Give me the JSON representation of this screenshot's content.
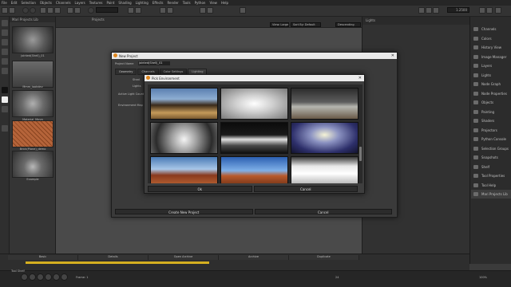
{
  "menu": [
    "File",
    "Edit",
    "Selection",
    "Objects",
    "Channels",
    "Layers",
    "Textures",
    "Paint",
    "Shading",
    "Lighting",
    "Effects",
    "Render",
    "Tools",
    "Python",
    "View",
    "Help"
  ],
  "toolbar": {
    "camera_label": "Camera",
    "size_value": "1024",
    "zoom": "1.2500"
  },
  "projects_panel": {
    "title": "Mari Projects Lib",
    "items": [
      {
        "name": "jointed(Shell)_01",
        "icon": "hexnut-thumbnail"
      },
      {
        "name": "Mmm_lookdev",
        "icon": "robot-thumbnail"
      },
      {
        "name": "Material_Mmm",
        "icon": "grey-sphere-thumbnail"
      },
      {
        "name": "Brick(Plane)_demo",
        "icon": "brick-thumbnail"
      },
      {
        "name": "Example",
        "icon": "box-thumbnail"
      }
    ]
  },
  "viewport": {
    "title": "Projects",
    "view_mode": "View: Large",
    "sort": "Sort By: Default",
    "order": "Descending"
  },
  "right_panel": {
    "title": "Lights"
  },
  "palettes": [
    "Channels",
    "Colors",
    "History View",
    "Image Manager",
    "Layers",
    "Lights",
    "Node Graph",
    "Node Properties",
    "Objects",
    "Painting",
    "Shaders",
    "Projectors",
    "Python Console",
    "Selection Groups",
    "Snapshots",
    "Shelf",
    "Tool Properties",
    "Tool Help",
    "Mari Projects Lib"
  ],
  "shelf": {
    "tabs": [
      "Basic",
      "Details",
      "Open Archive",
      "Archive",
      "Duplicate"
    ],
    "label": "Tool Shelf"
  },
  "statusbar": {
    "frame": "Frame: 1",
    "fps": "24",
    "zoom": "100%"
  },
  "new_project_dialog": {
    "title": "New Project",
    "name_label": "Project Name",
    "name_value": "jointed(Shell)_01",
    "tabs": [
      "Geometry",
      "Channels",
      "Color Settings",
      "Lighting"
    ],
    "rows": [
      "Shad",
      "Lights",
      "Active Light Count",
      "Environment Map"
    ],
    "create_button": "Create New Project",
    "cancel_button": "Cancel"
  },
  "env_picker": {
    "title": "Pick Environment",
    "ok_button": "Ok",
    "cancel_button": "Cancel",
    "maps": [
      {
        "name": "teapot-hdri",
        "gradient": "linear-gradient(180deg,#5a7fb0 0%,#8eaed2 35%,#3a2a1a 55%,#c49a5a 80%,#7a5a30 100%)"
      },
      {
        "name": "white-studio-hdri",
        "gradient": "radial-gradient(ellipse at 50% 50%,#ffffff 0%,#cfcfcf 40%,#7a7a7a 100%)"
      },
      {
        "name": "canyon-grey-hdri",
        "gradient": "linear-gradient(180deg,#2c2c2c 0%,#5e5e5e 45%,#b6b6b0 60%,#6a5a48 100%)"
      },
      {
        "name": "silver-sphere-hdri",
        "gradient": "radial-gradient(circle at 50% 55%,#f4f4f4 0%,#9b9b9b 35%,#2b2b2b 75%,#6a6a6a 100%)"
      },
      {
        "name": "dark-tunnel-hdri",
        "gradient": "linear-gradient(180deg,#0b0b0b 0%,#1a1a1a 40%,#e0e0e0 55%,#4a4a4a 75%,#101010 100%)"
      },
      {
        "name": "blue-hall-hdri",
        "gradient": "radial-gradient(ellipse at 50% 40%,#f5f3d6 0%,#8c93c2 30%,#2d2f6a 70%,#12132d 100%)"
      },
      {
        "name": "desert-red-hdri",
        "gradient": "linear-gradient(180deg,#4a7bb6 0%,#a8c6e8 40%,#8a3a1e 60%,#c06a36 100%)"
      },
      {
        "name": "desert-sky-hdri",
        "gradient": "linear-gradient(180deg,#2c60b2 0%,#7fb0e8 45%,#b85a2c 62%,#6a2c12 100%)"
      },
      {
        "name": "white-room-hdri",
        "gradient": "linear-gradient(180deg,#3a3a3a 0%,#e8e8e8 30%,#ffffff 55%,#a0a0a0 100%)"
      }
    ]
  }
}
